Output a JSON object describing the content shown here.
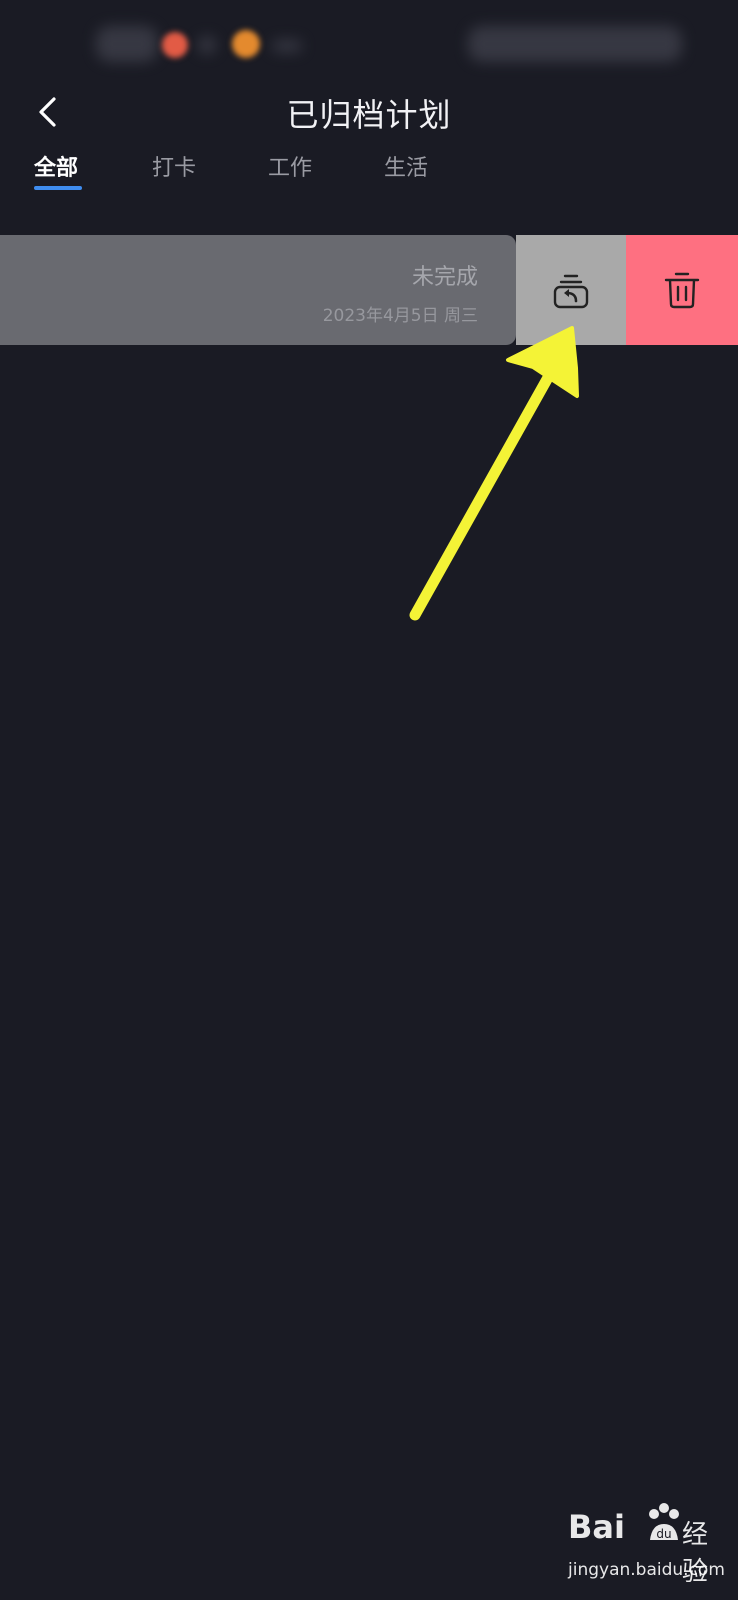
{
  "header": {
    "title": "已归档计划"
  },
  "tabs": [
    {
      "label": "全部",
      "active": true
    },
    {
      "label": "打卡",
      "active": false
    },
    {
      "label": "工作",
      "active": false
    },
    {
      "label": "生活",
      "active": false
    }
  ],
  "archived_items": [
    {
      "status": "未完成",
      "date": "2023年4月5日 周三",
      "actions": [
        {
          "icon": "restore-icon",
          "color": "#a9a9a9"
        },
        {
          "icon": "trash-icon",
          "color": "#fe7081"
        }
      ]
    }
  ],
  "colors": {
    "background": "#1a1b24",
    "accent": "#3f8df0",
    "delete": "#fe7081",
    "annotation_arrow": "#f4f336"
  },
  "watermark": {
    "brand": "Bai",
    "brand_suffix": "经验",
    "url": "jingyan.baidu.com"
  }
}
